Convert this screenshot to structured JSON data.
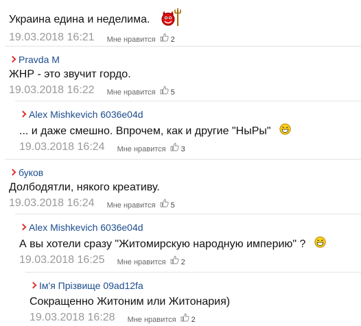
{
  "like_label": "Мне нравится",
  "comments": [
    {
      "author": "",
      "text": "Украина едина и неделима.",
      "date": "19.03.2018 16:21",
      "likes": "2",
      "icon": "devil-emoticon-icon"
    },
    {
      "author": "Pravda M",
      "text": "ЖНР - это звучит гордо.",
      "date": "19.03.2018 16:22",
      "likes": "5"
    },
    {
      "author": "Alex Mishkevich 6036e04d",
      "text": "... и даже смешно. Впрочем, как и другие \"НыРы\"",
      "date": "19.03.2018 16:24",
      "likes": "3",
      "icon": "smiley-icon"
    },
    {
      "author": "буков",
      "text": "Долбодятли, някого креативу.",
      "date": "19.03.2018 16:24",
      "likes": "5"
    },
    {
      "author": "Alex Mishkevich 6036e04d",
      "text": "А вы хотели сразу \"Житомирскую народную империю\" ?",
      "date": "19.03.2018 16:25",
      "likes": "2",
      "icon": "smiley-icon"
    },
    {
      "author": "Ім'я Прізвище 09ad12fa",
      "text": "Сокращенно Житоним или Житонария)",
      "date": "19.03.2018 16:28",
      "likes": "2"
    }
  ]
}
